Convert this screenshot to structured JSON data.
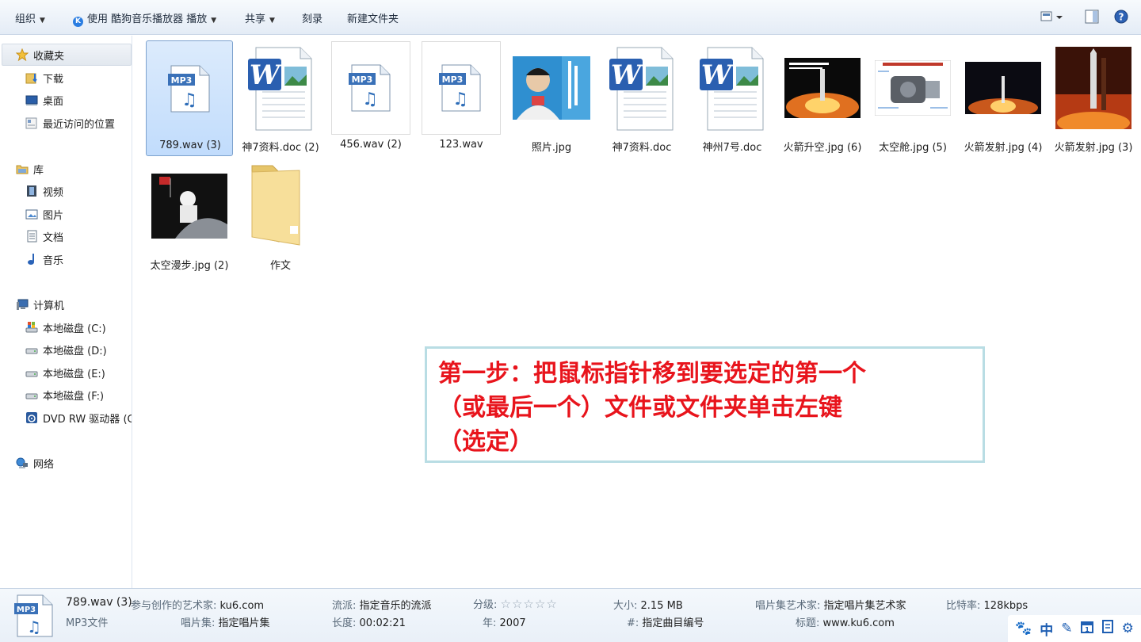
{
  "toolbar": {
    "organize": "组织",
    "play_with": "使用 酷狗音乐播放器 播放",
    "share": "共享",
    "burn": "刻录",
    "new_folder": "新建文件夹"
  },
  "sidebar": {
    "favorites": {
      "label": "收藏夹",
      "items": [
        {
          "label": "下载"
        },
        {
          "label": "桌面"
        },
        {
          "label": "最近访问的位置"
        }
      ]
    },
    "libraries": {
      "label": "库",
      "items": [
        {
          "label": "视频"
        },
        {
          "label": "图片"
        },
        {
          "label": "文档"
        },
        {
          "label": "音乐"
        }
      ]
    },
    "computer": {
      "label": "计算机",
      "items": [
        {
          "label": "本地磁盘 (C:)"
        },
        {
          "label": "本地磁盘 (D:)"
        },
        {
          "label": "本地磁盘 (E:)"
        },
        {
          "label": "本地磁盘 (F:)"
        },
        {
          "label": "DVD RW 驱动器 (G"
        }
      ]
    },
    "network": {
      "label": "网络"
    }
  },
  "files": [
    {
      "name": "789.wav (3)",
      "type": "mp3",
      "selected": true
    },
    {
      "name": "神7资料.doc (2)",
      "type": "doc"
    },
    {
      "name": "456.wav (2)",
      "type": "mp3"
    },
    {
      "name": "123.wav",
      "type": "mp3"
    },
    {
      "name": "照片.jpg",
      "type": "photo"
    },
    {
      "name": "神7资料.doc",
      "type": "doc"
    },
    {
      "name": "神州7号.doc",
      "type": "doc"
    },
    {
      "name": "火箭升空.jpg (6)",
      "type": "rocket"
    },
    {
      "name": "太空舱.jpg (5)",
      "type": "capsule"
    },
    {
      "name": "火箭发射.jpg (4)",
      "type": "launch"
    },
    {
      "name": "火箭发射.jpg (3)",
      "type": "tower"
    },
    {
      "name": "太空漫步.jpg (2)",
      "type": "spacewalk"
    },
    {
      "name": "作文",
      "type": "folder"
    }
  ],
  "icon_labels": {
    "mp3": "MP3",
    "word": "W"
  },
  "callout": {
    "text": "第一步：把鼠标指针移到要选定的第一个\n（或最后一个）文件或文件夹单击左键\n（选定）",
    "color": "#e8141c"
  },
  "details": {
    "filename": "789.wav (3)",
    "filetype": "MP3文件",
    "artist_k": "参与创作的艺术家:",
    "artist_v": "ku6.com",
    "album_k": "唱片集:",
    "album_v": "指定唱片集",
    "genre_k": "流派:",
    "genre_v": "指定音乐的流派",
    "length_k": "长度:",
    "length_v": "00:02:21",
    "rating_k": "分级:",
    "rating_v": "☆☆☆☆☆",
    "year_k": "年:",
    "year_v": "2007",
    "size_k": "大小:",
    "size_v": "2.15 MB",
    "track_k": "#:",
    "track_v": "指定曲目编号",
    "album_artist_k": "唱片集艺术家:",
    "album_artist_v": "指定唱片集艺术家",
    "title_k": "标题:",
    "title_v": "www.ku6.com",
    "bitrate_k": "比特率:",
    "bitrate_v": "128kbps"
  },
  "ime": {
    "lang": "中"
  }
}
